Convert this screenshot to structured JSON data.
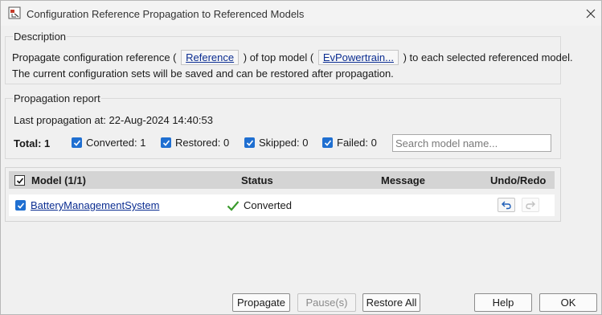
{
  "window": {
    "title": "Configuration Reference Propagation to Referenced Models"
  },
  "description": {
    "heading": "Description",
    "line1_prefix": "Propagate configuration reference (",
    "reference_link": "Reference",
    "line1_mid": ") of top model (",
    "top_model_link": "EvPowertrain...",
    "line1_suffix": ") to each selected referenced model.",
    "line2": "The current configuration sets will be saved and can be restored after propagation."
  },
  "report": {
    "heading": "Propagation report",
    "last_propagation_label": "Last propagation at:",
    "last_propagation_time": "22-Aug-2024 14:40:53",
    "total_label": "Total: 1",
    "filters": [
      {
        "label": "Converted: 1",
        "checked": true
      },
      {
        "label": "Restored: 0",
        "checked": true
      },
      {
        "label": "Skipped: 0",
        "checked": true
      },
      {
        "label": "Failed: 0",
        "checked": true
      }
    ],
    "search_placeholder": "Search model name..."
  },
  "table": {
    "columns": [
      "Model (1/1)",
      "Status",
      "Message",
      "Undo/Redo"
    ],
    "rows": [
      {
        "model": "BatteryManagementSystem",
        "status": "Converted",
        "message": "",
        "checked": true
      }
    ]
  },
  "buttons": {
    "propagate": "Propagate",
    "pause": "Pause(s)",
    "restore_all": "Restore All",
    "help": "Help",
    "ok": "OK"
  },
  "colors": {
    "accent": "#1f6fd1",
    "link": "#0b2d91",
    "success": "#3a9a2c",
    "header_bg": "#d4d4d4"
  },
  "icons": [
    "app-icon",
    "close-icon",
    "checkbox-icon",
    "checkmark-icon",
    "undo-icon",
    "redo-icon"
  ]
}
